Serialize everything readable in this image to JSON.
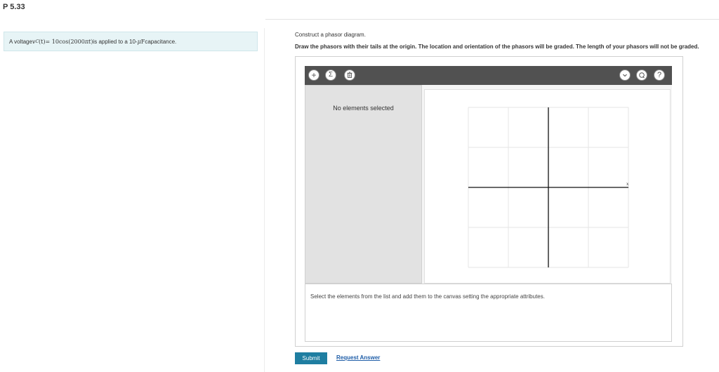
{
  "header": {
    "title": "P 5.33"
  },
  "problem": {
    "prefix": "A voltage ",
    "voltage_symbol": "v",
    "voltage_subscript": "C",
    "voltage_arg": "(t)",
    "equals_expr": " = 10cos(2000",
    "pi_t": "πt",
    "close_paren": ")",
    "mid": " is applied to a 10-",
    "mu": "μ",
    "farad": "F",
    "suffix": " capacitance."
  },
  "instructions": {
    "line1": "Construct a phasor diagram.",
    "line2": "Draw the phasors with their tails at the origin. The location and orientation of the phasors will be graded. The length of your phasors will not be graded."
  },
  "toolbar": {
    "add_icon": "plus-icon",
    "sum_icon": "sigma-icon",
    "delete_icon": "trash-icon",
    "chevron_icon": "chevron-down-icon",
    "reset_icon": "reset-icon",
    "help_icon": "help-icon",
    "plus_glyph": "+",
    "sigma_glyph": "Σ",
    "chevron_glyph": "⌄",
    "help_glyph": "?"
  },
  "left_panel": {
    "empty_text": "No elements selected"
  },
  "canvas": {
    "x_axis_label": "x"
  },
  "bottom_panel": {
    "hint": "Select the elements from the list and add them to the canvas setting the appropriate attributes."
  },
  "actions": {
    "submit_label": "Submit",
    "request_answer_label": "Request Answer"
  },
  "colors": {
    "toolbar_bg": "#515151",
    "submit_bg": "#1f7ea1",
    "problem_bg": "#e7f4f6",
    "link": "#1f5ea8"
  }
}
